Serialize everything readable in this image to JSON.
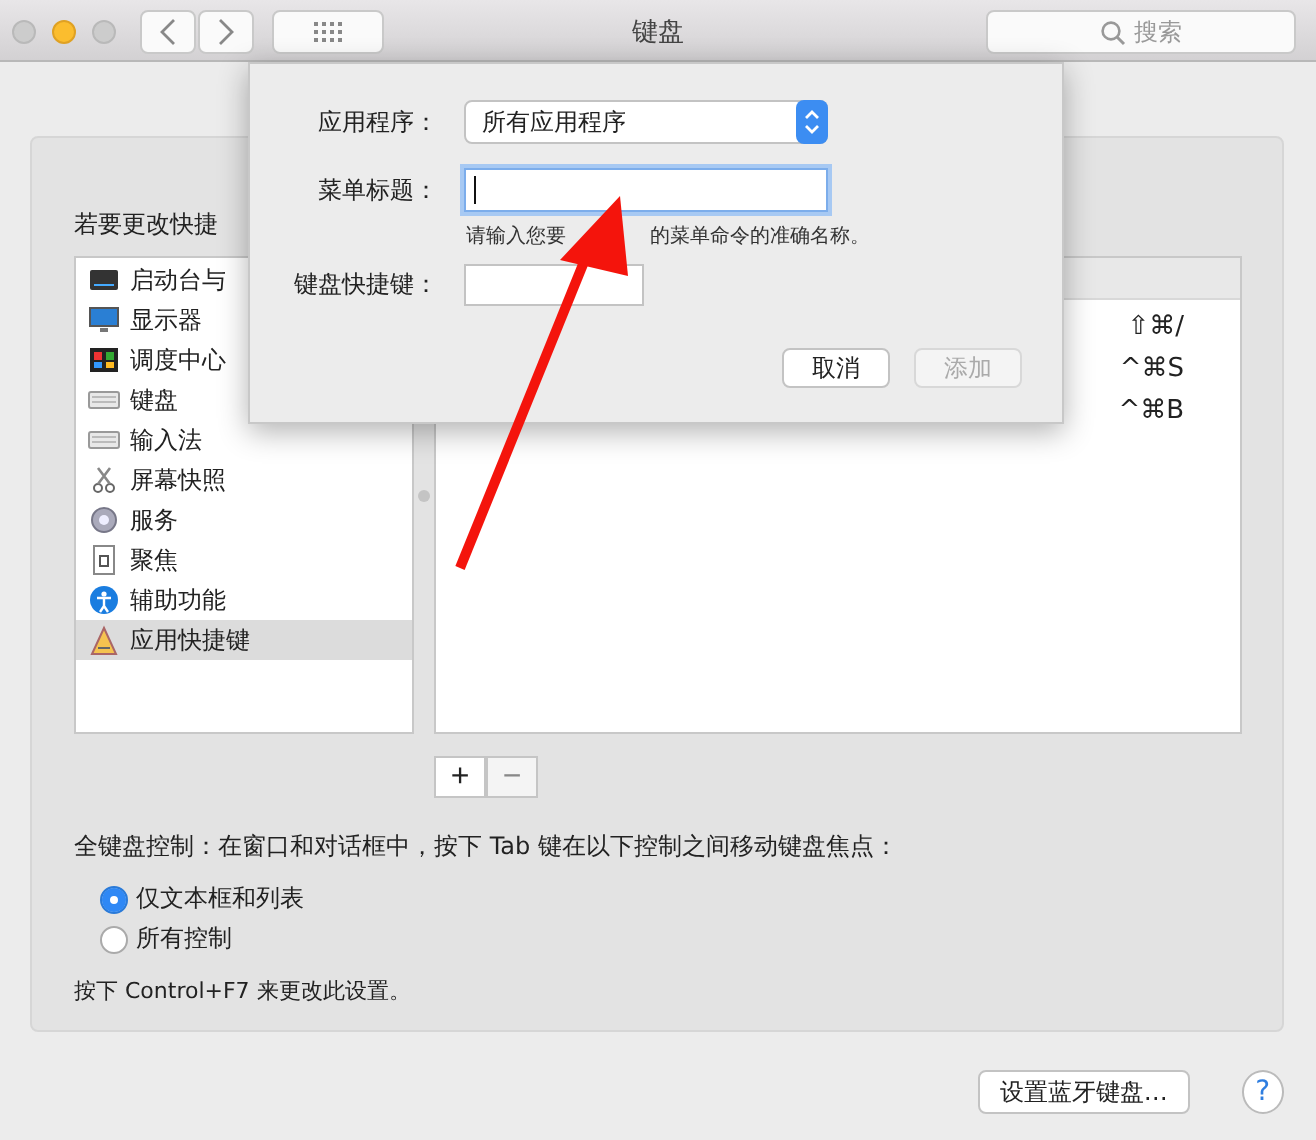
{
  "window": {
    "title": "键盘",
    "search_placeholder": "搜索"
  },
  "panel": {
    "heading": "若要更改快捷",
    "categories": [
      {
        "label": "启动台与",
        "selected": false
      },
      {
        "label": "显示器",
        "selected": false
      },
      {
        "label": "调度中心",
        "selected": false
      },
      {
        "label": "键盘",
        "selected": false
      },
      {
        "label": "输入法",
        "selected": false
      },
      {
        "label": "屏幕快照",
        "selected": false
      },
      {
        "label": "服务",
        "selected": false
      },
      {
        "label": "聚焦",
        "selected": false
      },
      {
        "label": "辅助功能",
        "selected": false
      },
      {
        "label": "应用快捷键",
        "selected": true
      }
    ],
    "shortcuts": [
      "⇧⌘/",
      "^⌘S",
      "^⌘B"
    ],
    "add_button": {
      "label": "+",
      "disabled": false
    },
    "remove_button": {
      "label": "−",
      "disabled": true
    },
    "full_keyboard_label": "全键盘控制：在窗口和对话框中，按下 Tab 键在以下控制之间移动键盘焦点：",
    "options": [
      {
        "label": "仅文本框和列表",
        "selected": true
      },
      {
        "label": "所有控制",
        "selected": false
      }
    ],
    "note": "按下 Control+F7 来更改此设置。"
  },
  "bluetooth_button": "设置蓝牙键盘…",
  "help_button": "?",
  "dialog": {
    "app_label": "应用程序：",
    "app_value": "所有应用程序",
    "menu_label": "菜单标题：",
    "menu_hint": [
      "请输入您要",
      "的菜单命令的准确名称。"
    ],
    "shortcut_label": "键盘快捷键：",
    "buttons": [
      {
        "label": "取消",
        "disabled": false
      },
      {
        "label": "添加",
        "disabled": true
      }
    ]
  }
}
